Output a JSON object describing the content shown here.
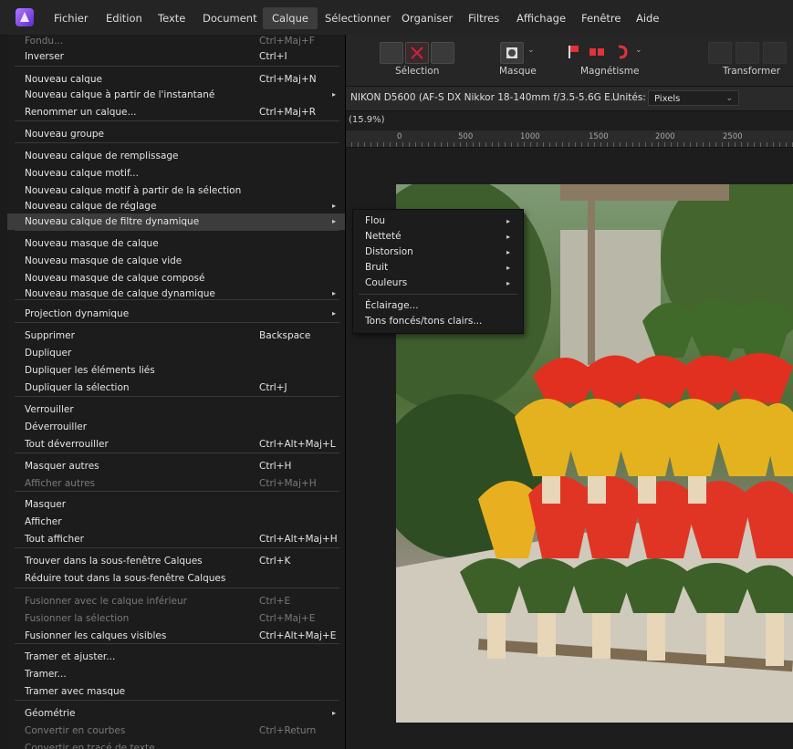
{
  "menubar": {
    "items": [
      "Fichier",
      "Edition",
      "Texte",
      "Document",
      "Calque",
      "Sélectionner",
      "Organiser",
      "Filtres",
      "Affichage",
      "Fenêtre",
      "Aide"
    ],
    "active": "Calque"
  },
  "toolbar": {
    "labels": [
      "Sélection",
      "Masque",
      "Magnétisme",
      "Transformer"
    ]
  },
  "context": {
    "camera": "NIKON D5600 (AF-S DX Nikkor 18-140mm f/3.5-5.6G E...",
    "units_label": "Unités:",
    "units_value": "Pixels"
  },
  "document": {
    "zoom": "(15.9%)"
  },
  "ruler": {
    "labels": [
      "0",
      "500",
      "1000",
      "1500",
      "2000",
      "2500"
    ]
  },
  "menu": {
    "items": [
      {
        "label": "Fondu...",
        "shortcut": "Ctrl+Maj+F",
        "disabled": true
      },
      {
        "label": "Inverser",
        "shortcut": "Ctrl+I"
      },
      {
        "label": "Nouveau calque",
        "shortcut": "Ctrl+Maj+N"
      },
      {
        "label": "Nouveau calque à partir de l'instantané",
        "shortcut": "",
        "submenu": true
      },
      {
        "label": "Renommer un calque...",
        "shortcut": "Ctrl+Maj+R"
      },
      {
        "label": "Nouveau groupe",
        "shortcut": ""
      },
      {
        "label": "Nouveau calque de remplissage",
        "shortcut": ""
      },
      {
        "label": "Nouveau calque motif...",
        "shortcut": ""
      },
      {
        "label": "Nouveau calque motif à partir de la sélection",
        "shortcut": ""
      },
      {
        "label": "Nouveau calque de réglage",
        "shortcut": "",
        "submenu": true
      },
      {
        "label": "Nouveau calque de filtre dynamique",
        "shortcut": "",
        "submenu": true,
        "highlighted": true
      },
      {
        "label": "Nouveau masque de calque",
        "shortcut": ""
      },
      {
        "label": "Nouveau masque de calque vide",
        "shortcut": ""
      },
      {
        "label": "Nouveau masque de calque composé",
        "shortcut": ""
      },
      {
        "label": "Nouveau masque de calque dynamique",
        "shortcut": "",
        "submenu": true
      },
      {
        "label": "Projection dynamique",
        "shortcut": "",
        "submenu": true
      },
      {
        "label": "Supprimer",
        "shortcut": "Backspace"
      },
      {
        "label": "Dupliquer",
        "shortcut": ""
      },
      {
        "label": "Dupliquer les éléments liés",
        "shortcut": ""
      },
      {
        "label": "Dupliquer la sélection",
        "shortcut": "Ctrl+J"
      },
      {
        "label": "Verrouiller",
        "shortcut": ""
      },
      {
        "label": "Déverrouiller",
        "shortcut": ""
      },
      {
        "label": "Tout déverrouiller",
        "shortcut": "Ctrl+Alt+Maj+L"
      },
      {
        "label": "Masquer autres",
        "shortcut": "Ctrl+H"
      },
      {
        "label": "Afficher autres",
        "shortcut": "Ctrl+Maj+H",
        "disabled": true
      },
      {
        "label": "Masquer",
        "shortcut": ""
      },
      {
        "label": "Afficher",
        "shortcut": ""
      },
      {
        "label": "Tout afficher",
        "shortcut": "Ctrl+Alt+Maj+H"
      },
      {
        "label": "Trouver dans la sous-fenêtre Calques",
        "shortcut": "Ctrl+K"
      },
      {
        "label": "Réduire tout dans la sous-fenêtre Calques",
        "shortcut": ""
      },
      {
        "label": "Fusionner avec le calque inférieur",
        "shortcut": "Ctrl+E",
        "disabled": true
      },
      {
        "label": "Fusionner la sélection",
        "shortcut": "Ctrl+Maj+E",
        "disabled": true
      },
      {
        "label": "Fusionner les calques visibles",
        "shortcut": "Ctrl+Alt+Maj+E"
      },
      {
        "label": "Tramer et ajuster...",
        "shortcut": ""
      },
      {
        "label": "Tramer...",
        "shortcut": ""
      },
      {
        "label": "Tramer avec masque",
        "shortcut": ""
      },
      {
        "label": "Géométrie",
        "shortcut": "",
        "submenu": true
      },
      {
        "label": "Convertir en courbes",
        "shortcut": "Ctrl+Return",
        "disabled": true
      },
      {
        "label": "Convertir en tracé de texte",
        "shortcut": "",
        "disabled": true
      }
    ]
  },
  "submenu": {
    "items": [
      {
        "label": "Flou",
        "submenu": true
      },
      {
        "label": "Netteté",
        "submenu": true
      },
      {
        "label": "Distorsion",
        "submenu": true
      },
      {
        "label": "Bruit",
        "submenu": true
      },
      {
        "label": "Couleurs",
        "submenu": true
      },
      {
        "label": "Éclairage..."
      },
      {
        "label": "Tons foncés/tons clairs..."
      }
    ]
  },
  "colors": {
    "menu_bg": "#1c1c1c",
    "highlight": "#3c3c3c",
    "disabled_text": "#7a7a7a",
    "red_flag_icon": "#e0333a"
  }
}
